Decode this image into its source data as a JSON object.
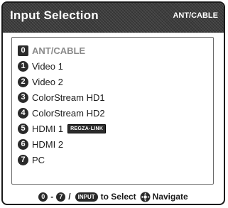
{
  "header": {
    "title": "Input Selection",
    "current_input": "ANT/CABLE"
  },
  "inputs": [
    {
      "number": "0",
      "label": "ANT/CABLE",
      "selected": true
    },
    {
      "number": "1",
      "label": "Video 1"
    },
    {
      "number": "2",
      "label": "Video 2"
    },
    {
      "number": "3",
      "label": "ColorStream HD1"
    },
    {
      "number": "4",
      "label": "ColorStream HD2"
    },
    {
      "number": "5",
      "label": "HDMI 1",
      "badge": "REGZA-LINK"
    },
    {
      "number": "6",
      "label": "HDMI 2"
    },
    {
      "number": "7",
      "label": "PC"
    }
  ],
  "footer": {
    "range_start": "0",
    "dash": "-",
    "range_end": "7",
    "slash": "/",
    "input_button": "INPUT",
    "select_text": "to Select",
    "navigate_text": "Navigate"
  }
}
